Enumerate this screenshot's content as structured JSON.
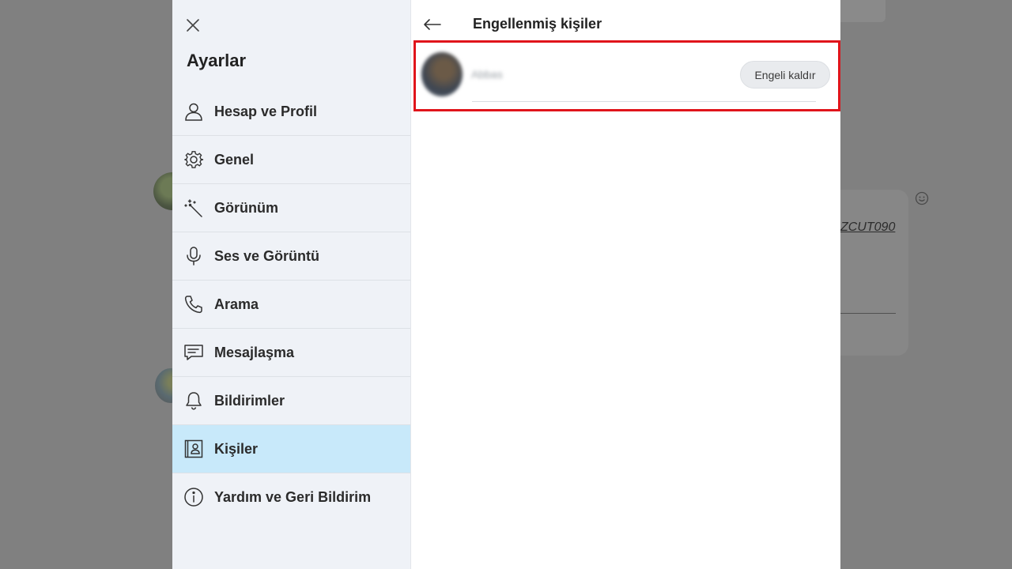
{
  "background": {
    "link_text": "ZCUT090"
  },
  "settings": {
    "title": "Ayarlar",
    "nav_items": [
      {
        "label": "Hesap ve Profil",
        "icon": "person-icon"
      },
      {
        "label": "Genel",
        "icon": "gear-icon"
      },
      {
        "label": "Görünüm",
        "icon": "magic-wand-icon"
      },
      {
        "label": "Ses ve Görüntü",
        "icon": "microphone-icon"
      },
      {
        "label": "Arama",
        "icon": "phone-icon"
      },
      {
        "label": "Mesajlaşma",
        "icon": "chat-icon"
      },
      {
        "label": "Bildirimler",
        "icon": "bell-icon"
      },
      {
        "label": "Kişiler",
        "icon": "contact-card-icon",
        "active": true
      },
      {
        "label": "Yardım ve Geri Bildirim",
        "icon": "info-icon"
      }
    ]
  },
  "blocked": {
    "title": "Engellenmiş kişiler",
    "contacts": [
      {
        "name": "Abbas",
        "unblock_label": "Engeli kaldır"
      }
    ]
  },
  "colors": {
    "active_nav": "#c8e9fa",
    "sidebar_bg": "#eff2f7",
    "highlight": "#e0141b",
    "overlay": "#808080"
  }
}
